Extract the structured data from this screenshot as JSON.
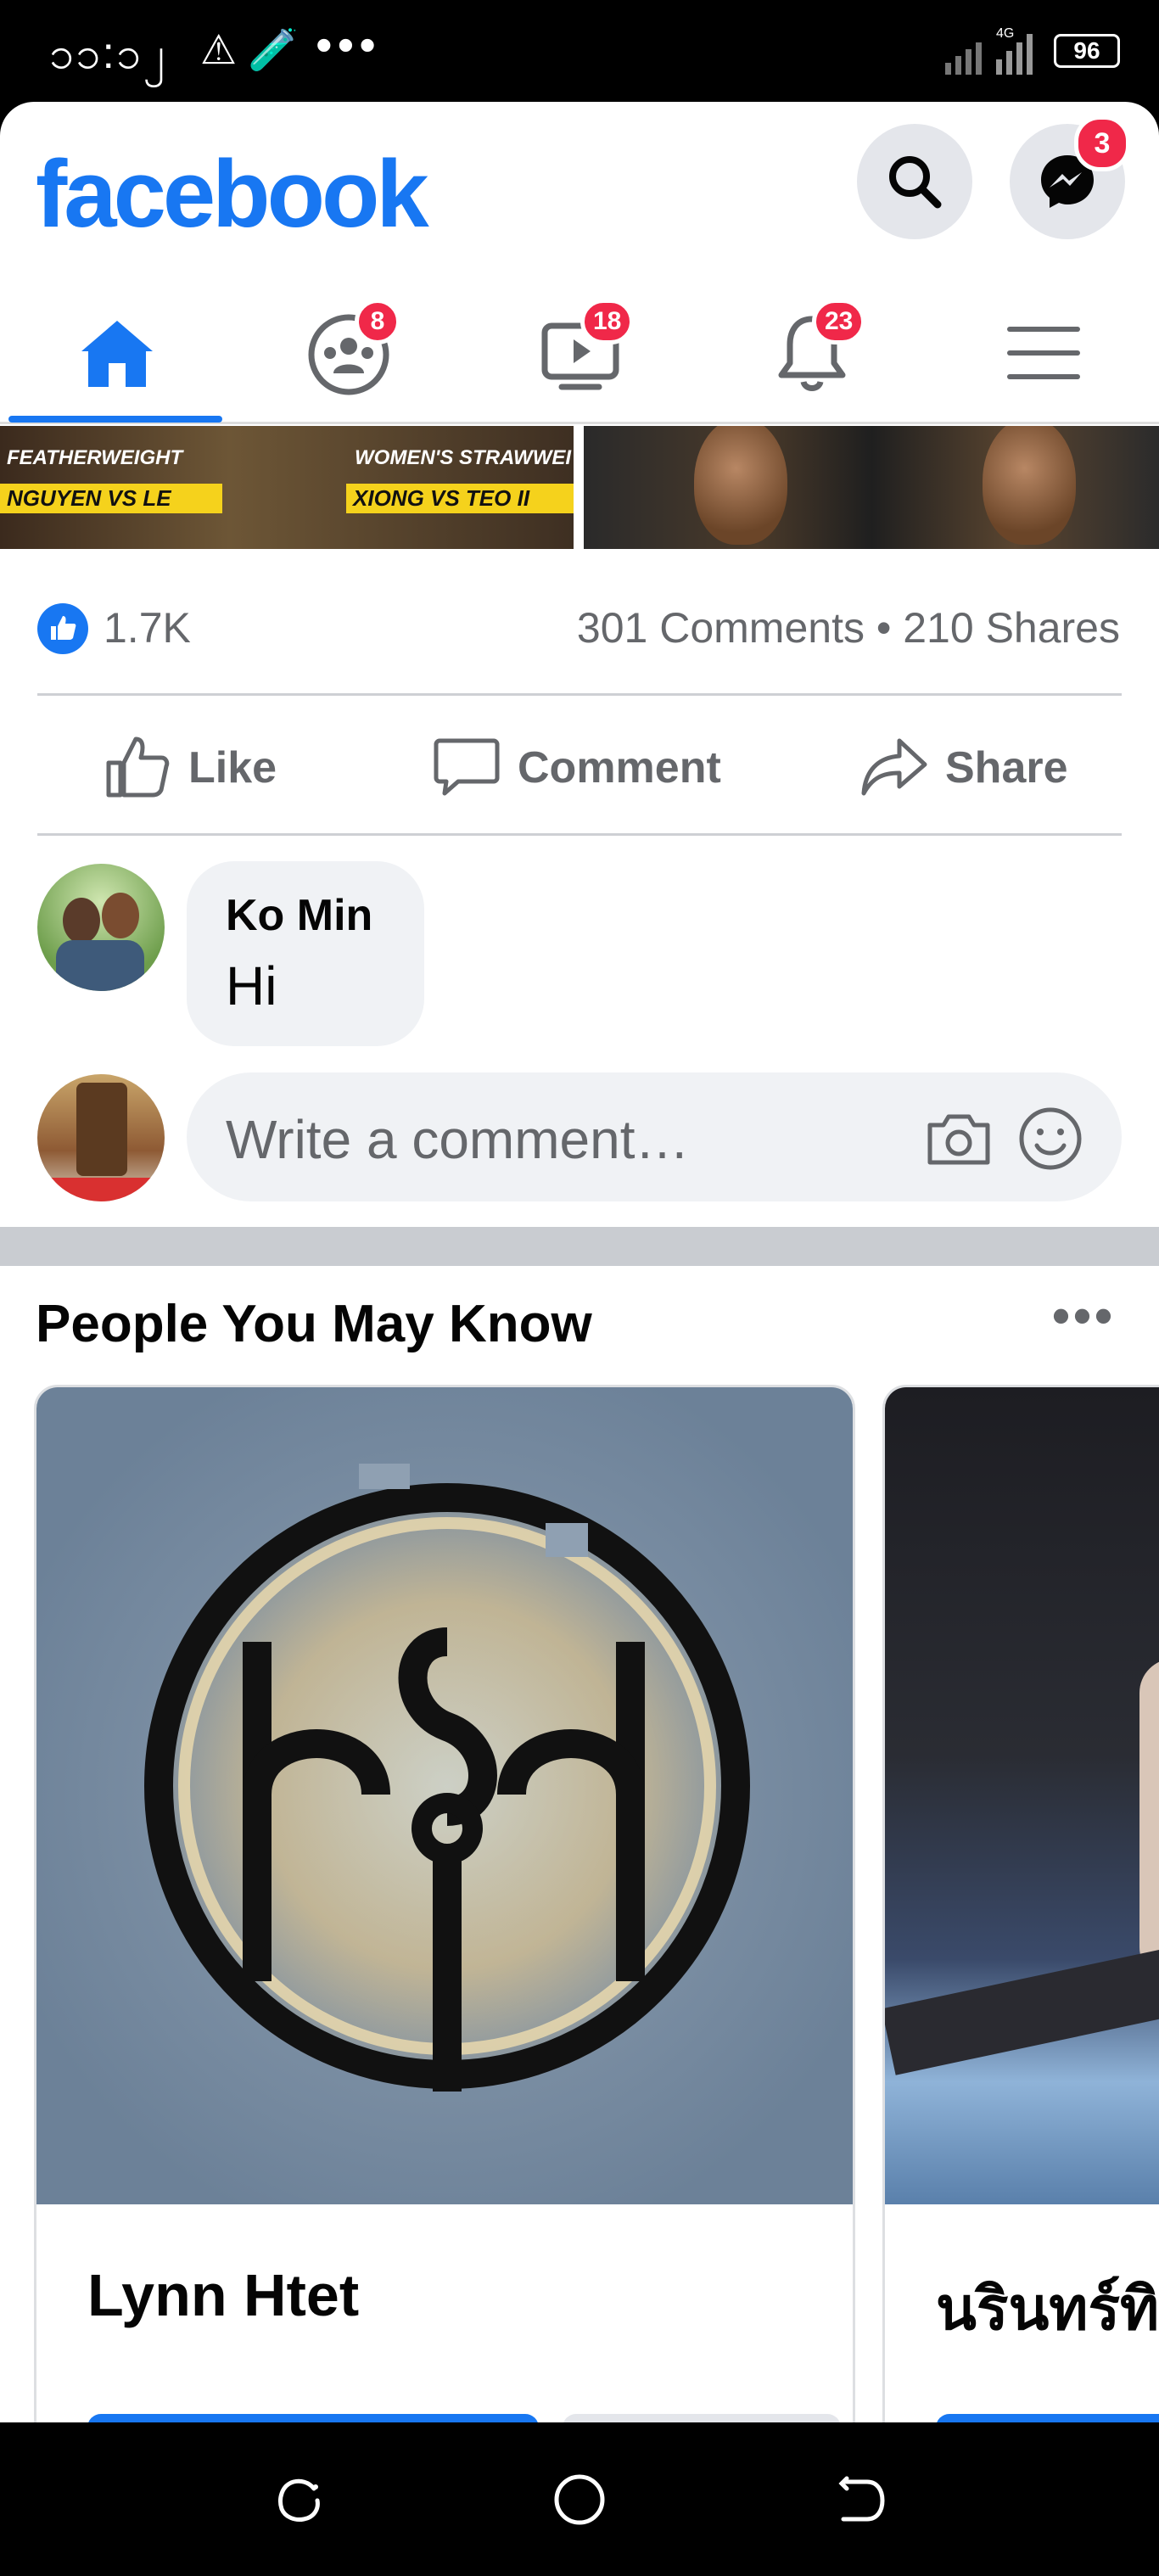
{
  "status_bar": {
    "time": "၁၁:၁၂",
    "icons": "⚠ 🧪",
    "dots": "•••",
    "network": "4G",
    "battery": "96"
  },
  "header": {
    "logo": "facebook",
    "search_icon": "search-icon",
    "messenger_icon": "messenger-icon",
    "messenger_badge": "3"
  },
  "tabs": [
    {
      "name": "home",
      "icon": "home-icon",
      "badge": ""
    },
    {
      "name": "groups",
      "icon": "groups-icon",
      "badge": "8"
    },
    {
      "name": "watch",
      "icon": "video-icon",
      "badge": "18"
    },
    {
      "name": "notifications",
      "icon": "bell-icon",
      "badge": "23"
    },
    {
      "name": "menu",
      "icon": "hamburger-icon",
      "badge": ""
    }
  ],
  "post": {
    "media_captions": {
      "left_top": "FEATHERWEIGHT",
      "left_bar": "NGUYEN VS LE",
      "right_top": "WOMEN'S STRAWWEI",
      "right_bar": "XIONG VS TEO II"
    },
    "reactions": {
      "likes": "1.7K",
      "comments_shares": "301 Comments • 210 Shares"
    },
    "actions": {
      "like": "Like",
      "comment": "Comment",
      "share": "Share"
    },
    "comment": {
      "author": "Ko Min",
      "text": "Hi"
    },
    "write_comment": {
      "placeholder": "Write a comment…"
    }
  },
  "pymk": {
    "title": "People You May Know",
    "more": "•••",
    "cards": [
      {
        "name": "Lynn Htet"
      },
      {
        "name": "นรินทร์ทิ"
      }
    ]
  },
  "colors": {
    "brand": "#1877f2",
    "badge": "#f02849",
    "muted": "#65676b",
    "bubble": "#f0f2f5"
  }
}
